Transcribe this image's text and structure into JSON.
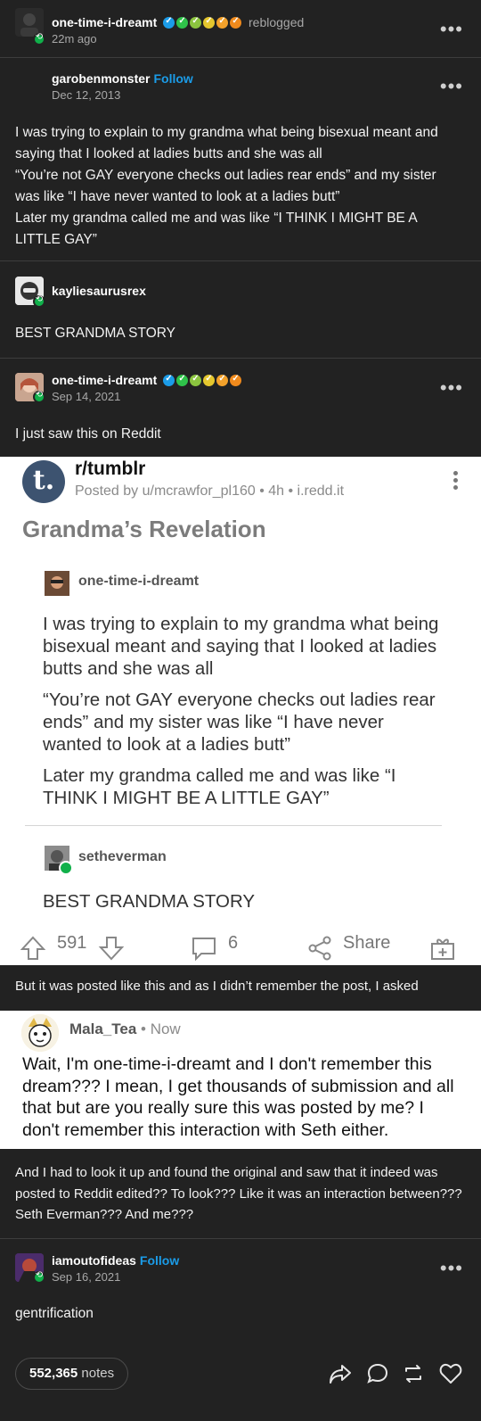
{
  "rebloggers": {
    "top": {
      "username": "one-time-i-dreamt",
      "action": "reblogged",
      "time": "22m ago"
    },
    "original": {
      "username": "garobenmonster",
      "follow": "Follow",
      "date": "Dec 12, 2013",
      "body": [
        "I was trying to explain to my grandma what being bisexual meant and saying that I looked at ladies butts and she was all",
        "“You’re not GAY everyone checks out ladies rear ends” and my sister was like “I have never wanted to look at a ladies butt”",
        "Later my grandma called me and was like “I THINK I MIGHT BE A LITTLE GAY”"
      ]
    },
    "kaylie": {
      "username": "kayliesaurusrex",
      "body": "BEST GRANDMA STORY"
    },
    "dreamt2": {
      "username": "one-time-i-dreamt",
      "date": "Sep 14, 2021",
      "body": "I just saw this on Reddit"
    },
    "middle_text": "But it was posted like this and as I didn’t remember the post, I asked",
    "after_text": "And I had to look it up and found the original and saw that it indeed was posted to Reddit edited?? To look??? Like it was an interaction between??? Seth Everman??? And me???",
    "last": {
      "username": "iamoutofideas",
      "follow": "Follow",
      "date": "Sep 16, 2021",
      "body": "gentrification"
    }
  },
  "badge_colors": [
    "#1b9ce8",
    "#2fc24a",
    "#8bc43f",
    "#e5c72e",
    "#f2a12b",
    "#f08a1c"
  ],
  "reddit_post": {
    "subreddit": "r/tumblr",
    "posted_by": "Posted by u/mcrawfor_pl160 • 4h • i.redd.it",
    "title": "Grandma’s Revelation",
    "inner_user1": "one-time-i-dreamt",
    "inner_paras": [
      "I was trying to explain to my grandma what being bisexual meant and saying that I looked at ladies butts and she was all",
      "“You’re not GAY everyone checks out ladies rear ends” and my sister was like “I have never wanted to look at a ladies butt”",
      "Later my grandma called me and was like “I THINK I MIGHT BE A LITTLE GAY”"
    ],
    "inner_user2": "setheverman",
    "inner_reply": "BEST GRANDMA STORY",
    "upvotes": "591",
    "comments": "6",
    "share": "Share"
  },
  "reddit_comment": {
    "user": "Mala_Tea",
    "time": "• Now",
    "text": "Wait, I'm one-time-i-dreamt and I don't remember this dream??? I mean, I get thousands of submission and all that but are you really sure this was posted by me? I don't remember this interaction with Seth either."
  },
  "footer": {
    "notes_count": "552,365",
    "notes_label": "notes"
  }
}
